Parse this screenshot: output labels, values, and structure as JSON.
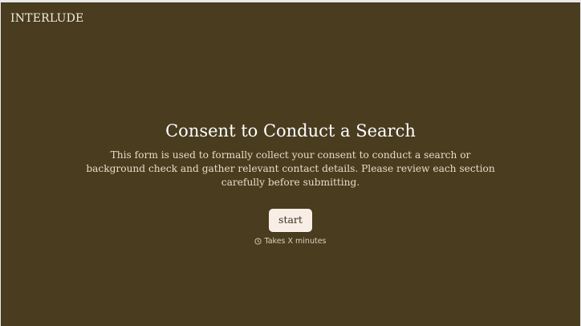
{
  "brand": "INTERLUDE",
  "intro": {
    "title": "Consent to Conduct a Search",
    "description": "This form is used to formally collect your consent to conduct a search or background check and gather relevant contact details. Please review each section carefully before submitting.",
    "start_label": "start",
    "duration_text": "Takes X minutes",
    "duration_icon": "clock-icon"
  },
  "colors": {
    "background": "#493c1f",
    "button": "#f8eee5",
    "title": "#ffffff"
  }
}
